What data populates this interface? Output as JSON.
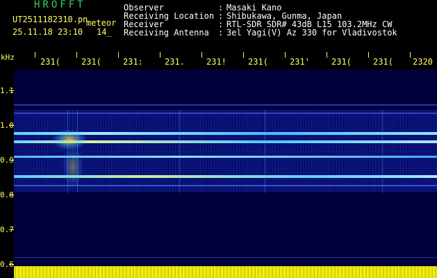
{
  "app_title": "HROFFT",
  "file": {
    "name": "UT2511182310.pn",
    "suffix": "meteor",
    "datetime": "25.11.18 23:10",
    "count": "14_"
  },
  "info": [
    {
      "label": "Observer",
      "value": "Masaki Kano"
    },
    {
      "label": "Receiving Location",
      "value": "Shibukawa, Gunma, Japan"
    },
    {
      "label": "Receiver",
      "value": "RTL-SDR SDR# 43dB L15 103.2MHz CW"
    },
    {
      "label": "Receiving Antenna",
      "value": "3el Yagi(V) Az 330 for Vladivostok"
    }
  ],
  "separator": ":",
  "axis": {
    "unit": "kHz",
    "x_ticks": [
      "231(",
      "231(",
      "231:",
      "231.",
      "231!",
      "231(",
      "231'",
      "231(",
      "231(",
      "2320"
    ],
    "y_ticks": [
      "1.1",
      "1.0",
      "0.9",
      "0.8",
      "0.7",
      "0.6"
    ]
  },
  "colors": {
    "accent": "#ffff66",
    "title": "#3cd35a",
    "background": "#00003a"
  }
}
